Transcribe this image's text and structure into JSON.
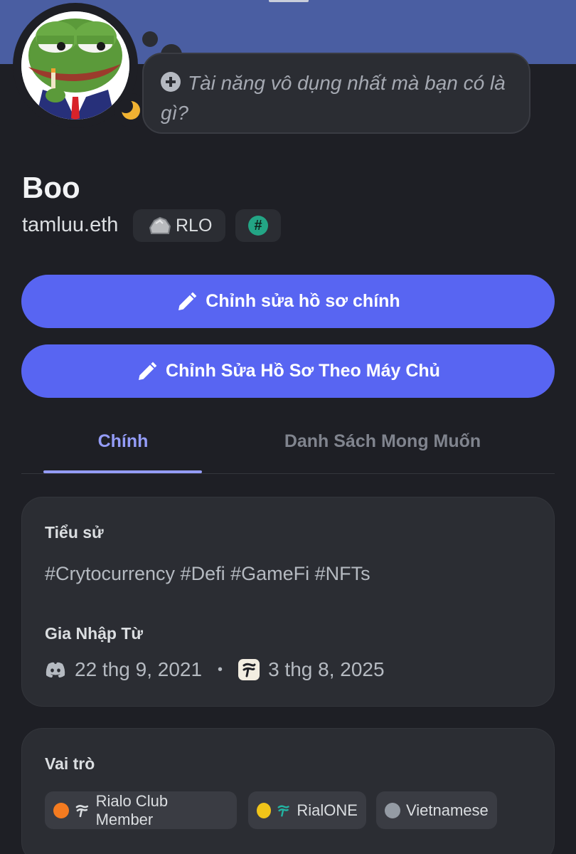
{
  "profile": {
    "display_name": "Boo",
    "username": "tamluu.eth",
    "status_prompt": "Tài năng vô dụng nhất mà bạn có là gì?",
    "tags": {
      "rlo_label": "RLO",
      "hash_label": "#"
    }
  },
  "actions": {
    "edit_main_profile": "Chỉnh sửa hồ sơ chính",
    "edit_server_profile": "Chỉnh Sửa Hồ Sơ Theo Máy Chủ"
  },
  "tabs": [
    {
      "label": "Chính",
      "active": true
    },
    {
      "label": "Danh Sách Mong Muốn",
      "active": false
    }
  ],
  "about": {
    "bio_heading": "Tiểu sử",
    "bio_text": "#Crytocurrency #Defi #GameFi #NFTs",
    "member_since_heading": "Gia Nhập Từ",
    "discord_join_date": "22 thg 9, 2021",
    "separator": "•",
    "server_join_date": "3 thg 8, 2025"
  },
  "roles": {
    "heading": "Vai trò",
    "items": [
      {
        "name": "Rialo Club Member",
        "color": "#f47b20"
      },
      {
        "name": "RialONE",
        "color": "#f0c419"
      },
      {
        "name": "Vietnamese",
        "color": "#949ba4"
      }
    ]
  },
  "colors": {
    "accent": "#5865f2",
    "tab_active": "#949cf7",
    "banner": "#4a5ea2",
    "status_idle": "#f0b232"
  }
}
